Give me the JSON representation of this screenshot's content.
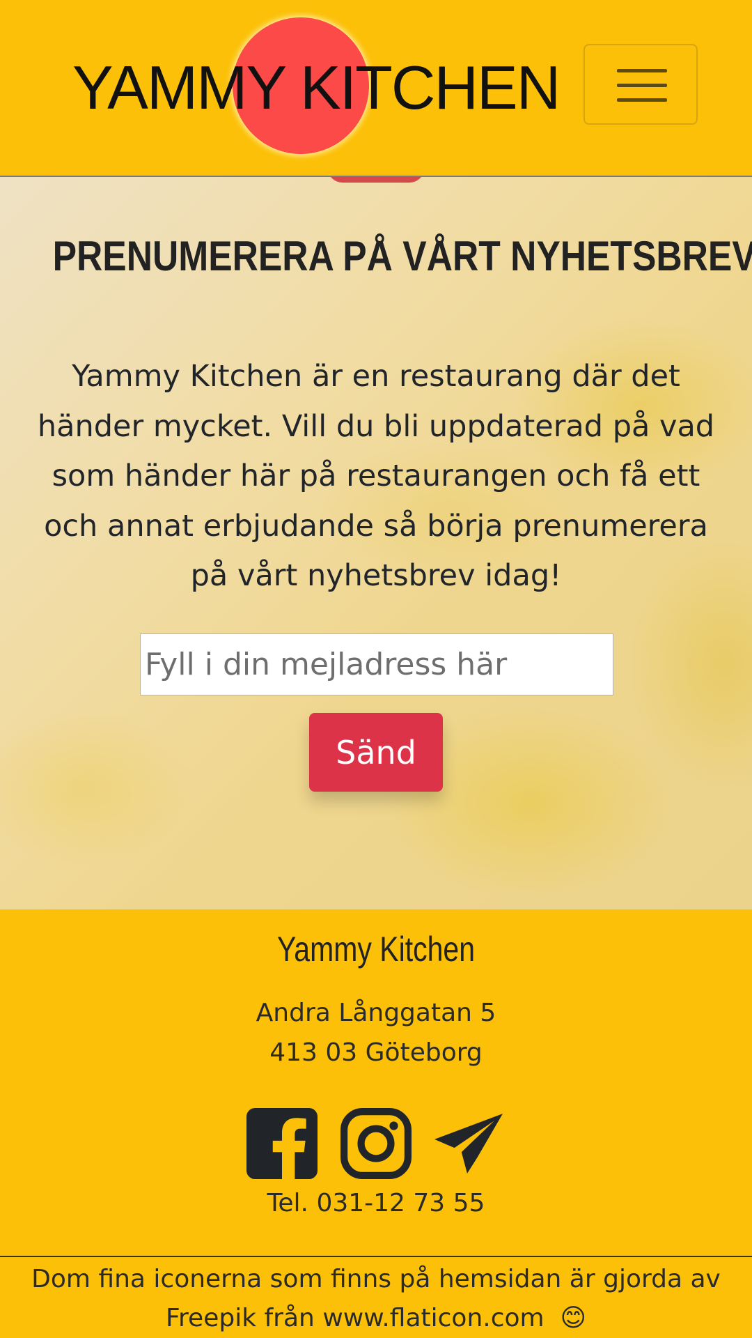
{
  "header": {
    "logo_text": "YAMMY KITCHEN",
    "menu_button_icon": "hamburger-menu-icon",
    "brand_color": "#fcc008",
    "logo_circle_color": "#fb4a48"
  },
  "newsletter": {
    "title": "PRENUMERERA PÅ VÅRT NYHETSBREV",
    "text": "Yammy Kitchen är en restaurang där det händer mycket. Vill du bli uppdaterad på vad som händer här på restaurangen och få ett och annat erbjudande så börja prenumerera på vårt nyhetsbrev idag!",
    "email_placeholder": "Fyll i din mejladress här",
    "email_value": "",
    "send_label": "Sänd",
    "send_color": "#dd3349"
  },
  "footer": {
    "name": "Yammy Kitchen",
    "street": "Andra Långgatan 5",
    "city": "413 03 Göteborg",
    "social_icons": [
      "facebook-icon",
      "instagram-icon",
      "telegram-icon"
    ],
    "phone": "Tel. 031-12 73 55",
    "credits_line1": "Dom fina iconerna som finns på hemsidan är gjorda av",
    "credits_freepik": "Freepik",
    "credits_from": " från ",
    "credits_link": "www.flaticon.com",
    "credits_emoji": "😊"
  }
}
